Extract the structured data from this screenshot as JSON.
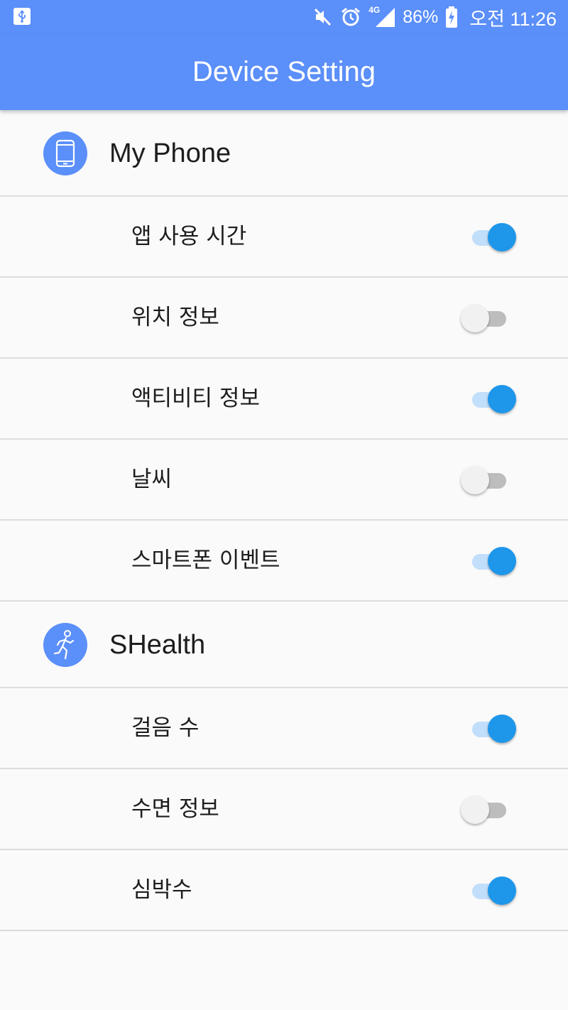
{
  "status_bar": {
    "battery": "86%",
    "network": "4G",
    "time": "오전 11:26",
    "icons": [
      "usb-icon",
      "mute-icon",
      "alarm-icon",
      "signal-icon",
      "charging-battery-icon"
    ]
  },
  "app_bar": {
    "title": "Device Setting"
  },
  "colors": {
    "primary": "#5b8ff9",
    "switch_on": "#1e96ea",
    "switch_on_track": "#c1defa",
    "switch_off_track": "#bdbdbd"
  },
  "sections": [
    {
      "title": "My Phone",
      "icon": "smartphone-icon",
      "items": [
        {
          "label": "앱 사용 시간",
          "enabled": true
        },
        {
          "label": "위치 정보",
          "enabled": false
        },
        {
          "label": "액티비티 정보",
          "enabled": true
        },
        {
          "label": "날씨",
          "enabled": false
        },
        {
          "label": "스마트폰 이벤트",
          "enabled": true
        }
      ]
    },
    {
      "title": "SHealth",
      "icon": "running-person-icon",
      "items": [
        {
          "label": "걸음 수",
          "enabled": true
        },
        {
          "label": "수면 정보",
          "enabled": false
        },
        {
          "label": "심박수",
          "enabled": true
        }
      ]
    }
  ]
}
